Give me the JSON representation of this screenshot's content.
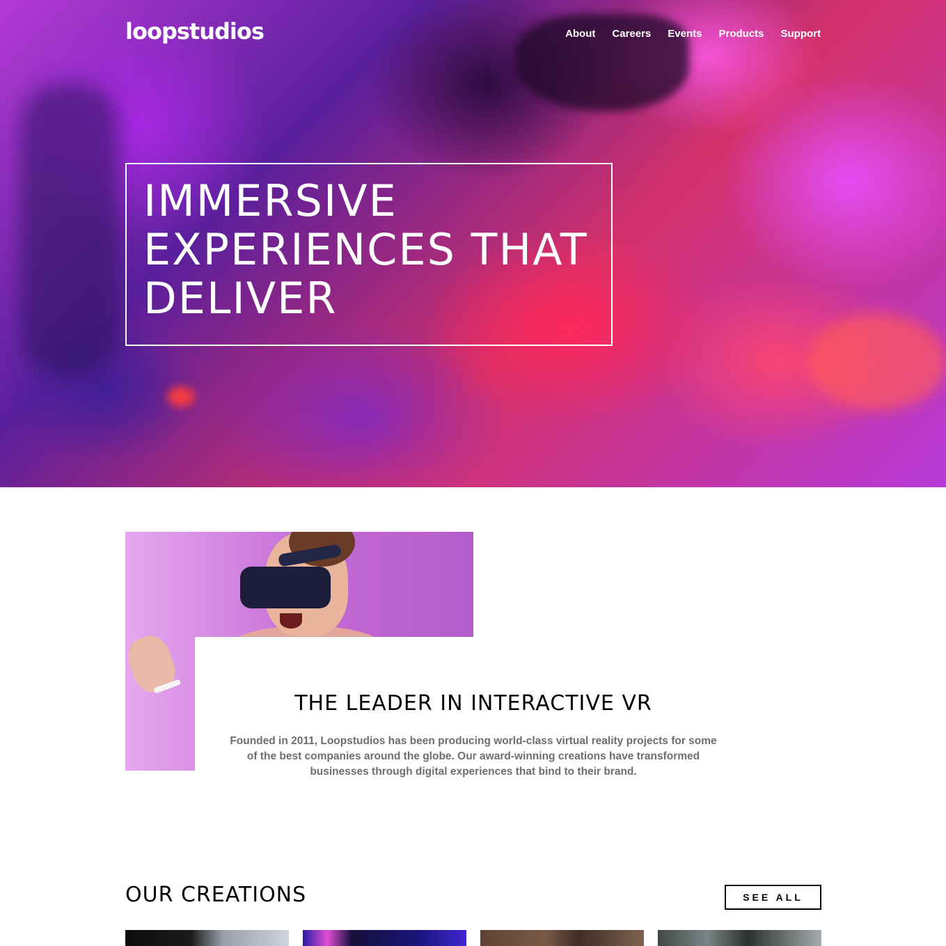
{
  "header": {
    "logo": "loopstudios",
    "nav": [
      "About",
      "Careers",
      "Events",
      "Products",
      "Support"
    ]
  },
  "hero": {
    "title_lines": [
      "IMMERSIVE",
      "EXPERIENCES THAT",
      "DELIVER"
    ]
  },
  "intro": {
    "title": "THE LEADER IN INTERACTIVE VR",
    "text": "Founded in 2011, Loopstudios has been producing world-class virtual reality projects for some of the best companies around the globe. Our award-winning creations have transformed businesses through digital experiences that bind to their brand."
  },
  "creations": {
    "title": "OUR CREATIONS",
    "see_all": "SEE ALL"
  },
  "colors": {
    "text_dark": "#000000",
    "text_muted": "#6e6e6e",
    "white": "#ffffff"
  }
}
